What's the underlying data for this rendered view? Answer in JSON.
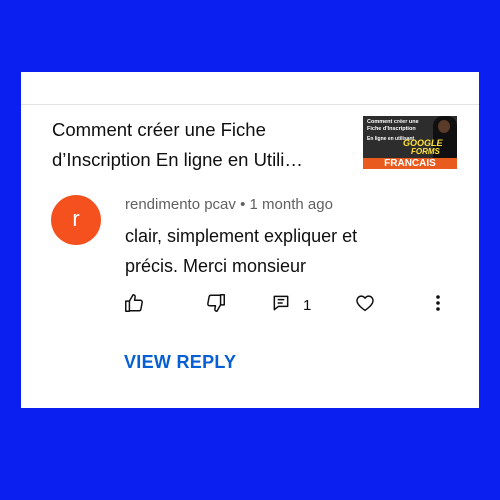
{
  "video": {
    "title": "Comment créer une Fiche d’Inscription En ligne en Utili…",
    "thumbnail": {
      "line1": "Comment créer une",
      "line2": "Fiche d'Inscription",
      "line3": "En ligne en utilisant",
      "line4": "GOOGLE",
      "line5": "FORMS",
      "banner": "FRANCAIS"
    }
  },
  "comment": {
    "avatar_letter": "r",
    "author": "rendimento pcav",
    "separator": "•",
    "time": "1 month ago",
    "text": "clair, simplement expliquer et précis. Merci monsieur",
    "reply_count": "1"
  },
  "actions": {
    "view_reply_label": "VIEW REPLY"
  },
  "colors": {
    "background": "#0a1ff0",
    "avatar": "#f4511e",
    "link": "#065fd4"
  }
}
